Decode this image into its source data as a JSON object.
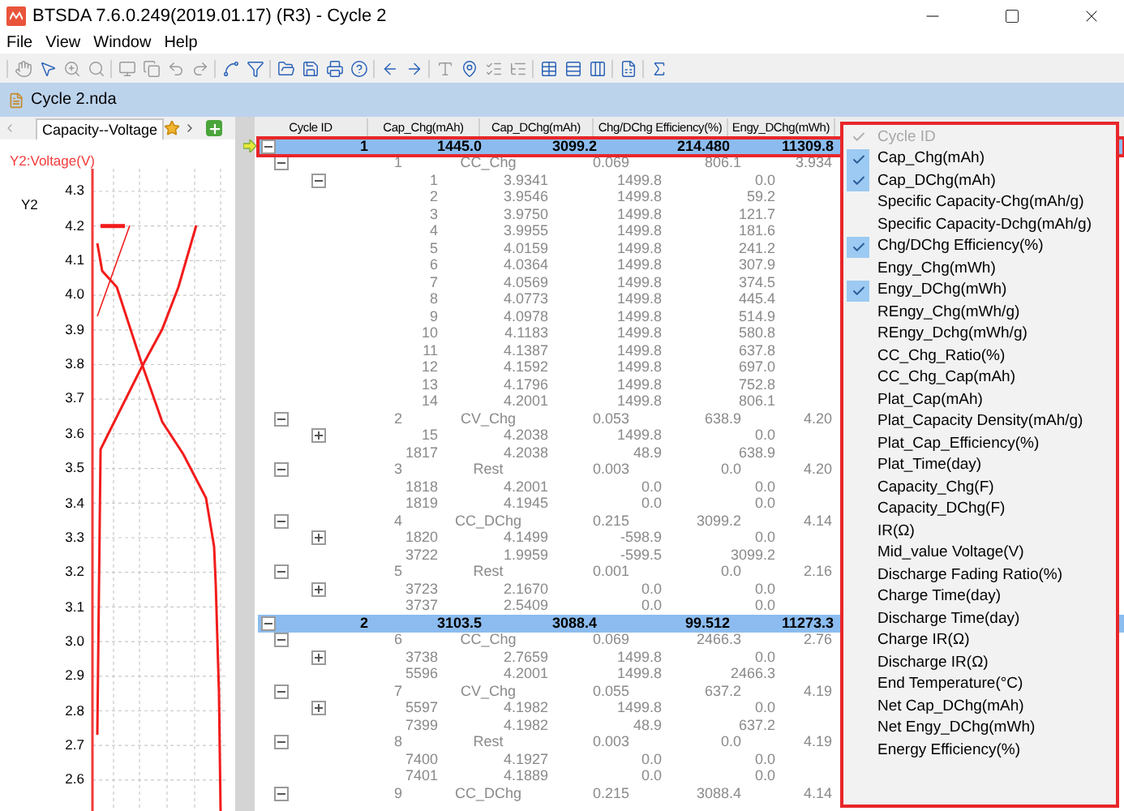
{
  "window": {
    "title": "BTSDA 7.6.0.249(2019.01.17) (R3) - Cycle 2"
  },
  "menu_bar": [
    "File",
    "View",
    "Window",
    "Help"
  ],
  "document": {
    "title": "Cycle 2.nda"
  },
  "chart_panel": {
    "tab": "Capacity--Voltage",
    "axis_title": "Y2:Voltage(V)",
    "axis_name": "Y2",
    "y_ticks": [
      "4.3",
      "4.2",
      "4.1",
      "4.0",
      "3.9",
      "3.8",
      "3.7",
      "3.6",
      "3.5",
      "3.4",
      "3.3",
      "3.2",
      "3.1",
      "3.0",
      "2.9",
      "2.8",
      "2.7",
      "2.6"
    ]
  },
  "table": {
    "columns": [
      "Cycle ID",
      "Cap_Chg(mAh)",
      "Cap_DChg(mAh)",
      "Chg/DChg Efficiency(%)",
      "Engy_DChg(mWh)"
    ],
    "cycles": [
      {
        "cells": [
          "1",
          "1445.0",
          "3099.2",
          "214.480",
          "11309.8"
        ],
        "selected": true,
        "current": true,
        "outlined": true,
        "expanded": true,
        "steps": [
          {
            "cells": [
              "1",
              "CC_Chg",
              "0.069",
              "806.1",
              "3.934"
            ],
            "expanded": true,
            "records": [
              {
                "kind": "group",
                "expanded": true,
                "cells": [
                  "1",
                  "3.9341",
                  "1499.8",
                  "0.0"
                ]
              },
              {
                "kind": "record",
                "cells": [
                  "2",
                  "3.9546",
                  "1499.8",
                  "59.2"
                ]
              },
              {
                "kind": "record",
                "cells": [
                  "3",
                  "3.9750",
                  "1499.8",
                  "121.7"
                ]
              },
              {
                "kind": "record",
                "cells": [
                  "4",
                  "3.9955",
                  "1499.8",
                  "181.6"
                ]
              },
              {
                "kind": "record",
                "cells": [
                  "5",
                  "4.0159",
                  "1499.8",
                  "241.2"
                ]
              },
              {
                "kind": "record",
                "cells": [
                  "6",
                  "4.0364",
                  "1499.8",
                  "307.9"
                ]
              },
              {
                "kind": "record",
                "cells": [
                  "7",
                  "4.0569",
                  "1499.8",
                  "374.5"
                ]
              },
              {
                "kind": "record",
                "cells": [
                  "8",
                  "4.0773",
                  "1499.8",
                  "445.4"
                ]
              },
              {
                "kind": "record",
                "cells": [
                  "9",
                  "4.0978",
                  "1499.8",
                  "514.9"
                ]
              },
              {
                "kind": "record",
                "cells": [
                  "10",
                  "4.1183",
                  "1499.8",
                  "580.8"
                ]
              },
              {
                "kind": "record",
                "cells": [
                  "11",
                  "4.1387",
                  "1499.8",
                  "637.8"
                ]
              },
              {
                "kind": "record",
                "cells": [
                  "12",
                  "4.1592",
                  "1499.8",
                  "697.0"
                ]
              },
              {
                "kind": "record",
                "cells": [
                  "13",
                  "4.1796",
                  "1499.8",
                  "752.8"
                ]
              },
              {
                "kind": "record",
                "cells": [
                  "14",
                  "4.2001",
                  "1499.8",
                  "806.1"
                ]
              }
            ]
          },
          {
            "cells": [
              "2",
              "CV_Chg",
              "0.053",
              "638.9",
              "4.20"
            ],
            "expanded": true,
            "records": [
              {
                "kind": "group",
                "expanded": false,
                "cells": [
                  "15",
                  "4.2038",
                  "1499.8",
                  "0.0"
                ]
              },
              {
                "kind": "record",
                "cells": [
                  "1817",
                  "4.2038",
                  "48.9",
                  "638.9"
                ]
              }
            ]
          },
          {
            "cells": [
              "3",
              "Rest",
              "0.003",
              "0.0",
              "4.20"
            ],
            "expanded": true,
            "records": [
              {
                "kind": "record",
                "cells": [
                  "1818",
                  "4.2001",
                  "0.0",
                  "0.0"
                ]
              },
              {
                "kind": "record",
                "cells": [
                  "1819",
                  "4.1945",
                  "0.0",
                  "0.0"
                ]
              }
            ]
          },
          {
            "cells": [
              "4",
              "CC_DChg",
              "0.215",
              "3099.2",
              "4.14"
            ],
            "expanded": true,
            "records": [
              {
                "kind": "group",
                "expanded": false,
                "cells": [
                  "1820",
                  "4.1499",
                  "-598.9",
                  "0.0"
                ]
              },
              {
                "kind": "record",
                "cells": [
                  "3722",
                  "1.9959",
                  "-599.5",
                  "3099.2"
                ]
              }
            ]
          },
          {
            "cells": [
              "5",
              "Rest",
              "0.001",
              "0.0",
              "2.16"
            ],
            "expanded": true,
            "records": [
              {
                "kind": "group",
                "expanded": false,
                "cells": [
                  "3723",
                  "2.1670",
                  "0.0",
                  "0.0"
                ]
              },
              {
                "kind": "record",
                "cells": [
                  "3737",
                  "2.5409",
                  "0.0",
                  "0.0"
                ]
              }
            ]
          }
        ]
      },
      {
        "cells": [
          "2",
          "3103.5",
          "3088.4",
          "99.512",
          "11273.3"
        ],
        "selected": true,
        "current": false,
        "outlined": false,
        "expanded": true,
        "steps": [
          {
            "cells": [
              "6",
              "CC_Chg",
              "0.069",
              "2466.3",
              "2.76"
            ],
            "expanded": true,
            "records": [
              {
                "kind": "group",
                "expanded": false,
                "cells": [
                  "3738",
                  "2.7659",
                  "1499.8",
                  "0.0"
                ]
              },
              {
                "kind": "record",
                "cells": [
                  "5596",
                  "4.2001",
                  "1499.8",
                  "2466.3"
                ]
              }
            ]
          },
          {
            "cells": [
              "7",
              "CV_Chg",
              "0.055",
              "637.2",
              "4.19"
            ],
            "expanded": true,
            "records": [
              {
                "kind": "group",
                "expanded": false,
                "cells": [
                  "5597",
                  "4.1982",
                  "1499.8",
                  "0.0"
                ]
              },
              {
                "kind": "record",
                "cells": [
                  "7399",
                  "4.1982",
                  "48.9",
                  "637.2"
                ]
              }
            ]
          },
          {
            "cells": [
              "8",
              "Rest",
              "0.003",
              "0.0",
              "4.19"
            ],
            "expanded": true,
            "records": [
              {
                "kind": "record",
                "cells": [
                  "7400",
                  "4.1927",
                  "0.0",
                  "0.0"
                ]
              },
              {
                "kind": "record",
                "cells": [
                  "7401",
                  "4.1889",
                  "0.0",
                  "0.0"
                ]
              }
            ]
          },
          {
            "cells": [
              "9",
              "CC_DChg",
              "0.215",
              "3088.4",
              "4.14"
            ],
            "expanded": true
          }
        ]
      }
    ]
  },
  "column_menu": [
    {
      "label": "Cycle ID",
      "checked": true,
      "disabled": true
    },
    {
      "label": "Cap_Chg(mAh)",
      "checked": true,
      "disabled": false
    },
    {
      "label": "Cap_DChg(mAh)",
      "checked": true,
      "disabled": false
    },
    {
      "label": "Specific Capacity-Chg(mAh/g)",
      "checked": false,
      "disabled": false
    },
    {
      "label": "Specific Capacity-Dchg(mAh/g)",
      "checked": false,
      "disabled": false
    },
    {
      "label": "Chg/DChg Efficiency(%)",
      "checked": true,
      "disabled": false
    },
    {
      "label": "Engy_Chg(mWh)",
      "checked": false,
      "disabled": false
    },
    {
      "label": "Engy_DChg(mWh)",
      "checked": true,
      "disabled": false
    },
    {
      "label": "REngy_Chg(mWh/g)",
      "checked": false,
      "disabled": false
    },
    {
      "label": "REngy_Dchg(mWh/g)",
      "checked": false,
      "disabled": false
    },
    {
      "label": "CC_Chg_Ratio(%)",
      "checked": false,
      "disabled": false
    },
    {
      "label": "CC_Chg_Cap(mAh)",
      "checked": false,
      "disabled": false
    },
    {
      "label": "Plat_Cap(mAh)",
      "checked": false,
      "disabled": false
    },
    {
      "label": "Plat_Capacity Density(mAh/g)",
      "checked": false,
      "disabled": false
    },
    {
      "label": "Plat_Cap_Efficiency(%)",
      "checked": false,
      "disabled": false
    },
    {
      "label": "Plat_Time(day)",
      "checked": false,
      "disabled": false
    },
    {
      "label": "Capacity_Chg(F)",
      "checked": false,
      "disabled": false
    },
    {
      "label": "Capacity_DChg(F)",
      "checked": false,
      "disabled": false
    },
    {
      "label": "IR(Ω)",
      "checked": false,
      "disabled": false
    },
    {
      "label": "Mid_value Voltage(V)",
      "checked": false,
      "disabled": false
    },
    {
      "label": "Discharge Fading Ratio(%)",
      "checked": false,
      "disabled": false
    },
    {
      "label": "Charge Time(day)",
      "checked": false,
      "disabled": false
    },
    {
      "label": "Discharge Time(day)",
      "checked": false,
      "disabled": false
    },
    {
      "label": "Charge IR(Ω)",
      "checked": false,
      "disabled": false
    },
    {
      "label": "Discharge IR(Ω)",
      "checked": false,
      "disabled": false
    },
    {
      "label": "End Temperature(°C)",
      "checked": false,
      "disabled": false
    },
    {
      "label": "Net Cap_DChg(mAh)",
      "checked": false,
      "disabled": false
    },
    {
      "label": "Net Engy_DChg(mWh)",
      "checked": false,
      "disabled": false
    },
    {
      "label": "Energy Efficiency(%)",
      "checked": false,
      "disabled": false
    }
  ]
}
